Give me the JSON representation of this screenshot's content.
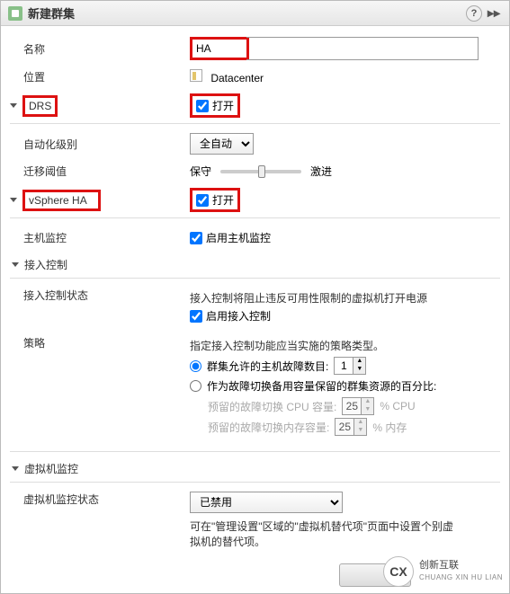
{
  "title": "新建群集",
  "fields": {
    "name_label": "名称",
    "name_value": "HA",
    "location_label": "位置",
    "location_value": "Datacenter"
  },
  "drs": {
    "header": "DRS",
    "turn_on": "打开",
    "automation_label": "自动化级别",
    "automation_value": "全自动",
    "threshold_label": "迁移阈值",
    "threshold_min": "保守",
    "threshold_max": "激进"
  },
  "ha": {
    "header": "vSphere HA",
    "turn_on": "打开",
    "host_monitor_label": "主机监控",
    "host_monitor_cb": "启用主机监控",
    "admission_header": "接入控制",
    "admission_status_label": "接入控制状态",
    "admission_desc": "接入控制将阻止违反可用性限制的虚拟机打开电源",
    "admission_cb": "启用接入控制",
    "policy_label": "策略",
    "policy_desc": "指定接入控制功能应当实施的策略类型。",
    "policy_radio1": "群集允许的主机故障数目:",
    "policy_radio1_val": "1",
    "policy_radio2": "作为故障切换备用容量保留的群集资源的百分比:",
    "cpu_label": "预留的故障切换 CPU 容量:",
    "cpu_val": "25",
    "cpu_unit": "%  CPU",
    "mem_label": "预留的故障切换内存容量:",
    "mem_val": "25",
    "mem_unit": "%  内存",
    "vm_monitor_header": "虚拟机监控",
    "vm_monitor_status_label": "虚拟机监控状态",
    "vm_monitor_value": "已禁用",
    "vm_monitor_desc": "可在\"管理设置\"区域的\"虚拟机替代项\"页面中设置个别虚拟机的替代项。"
  },
  "brand": {
    "logo": "CX",
    "name": "创新互联",
    "sub": "CHUANG XIN HU LIAN"
  }
}
